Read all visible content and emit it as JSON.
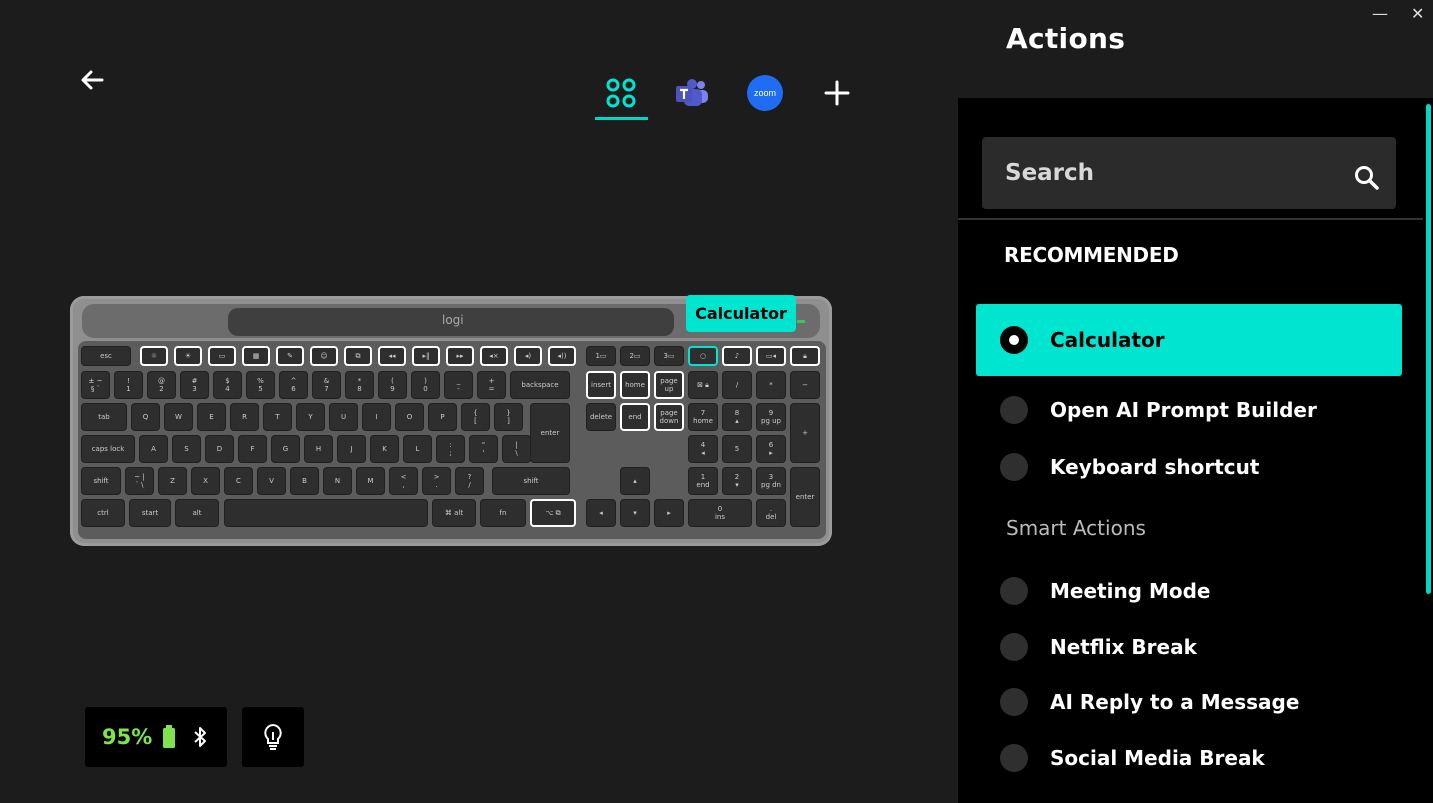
{
  "window": {
    "minimize": "—",
    "close": "✕"
  },
  "actions": {
    "title": "Actions",
    "search_placeholder": "Search",
    "recommended_label": "RECOMMENDED",
    "recommended": [
      {
        "label": "Calculator",
        "selected": true
      },
      {
        "label": "Open AI Prompt Builder",
        "selected": false
      },
      {
        "label": "Keyboard shortcut",
        "selected": false
      }
    ],
    "smart_label": "Smart Actions",
    "smart": [
      {
        "label": "Meeting Mode"
      },
      {
        "label": "Netflix Break"
      },
      {
        "label": "AI Reply to a Message"
      },
      {
        "label": "Social Media Break"
      }
    ]
  },
  "toolbar": {
    "zoom_label": "zoom",
    "add": "+"
  },
  "keyboard": {
    "brand": "logi",
    "tooltip": "Calculator",
    "keys": {
      "esc": "esc",
      "backspace": "backspace",
      "tab": "tab",
      "caps": "caps lock",
      "enter": "enter",
      "shift": "shift",
      "ctrl": "ctrl",
      "start": "start",
      "alt": "alt",
      "fn": "fn",
      "insert": "insert",
      "home": "home",
      "pgup": "page up",
      "delete": "delete",
      "end": "end",
      "pgdn": "page down",
      "numenter": "enter",
      "plus": "+",
      "minus": "−",
      "slash": "/",
      "star": "*"
    }
  },
  "status": {
    "battery": "95%",
    "battery_color": "#7ee34c"
  },
  "colors": {
    "accent": "#00e5cf"
  }
}
